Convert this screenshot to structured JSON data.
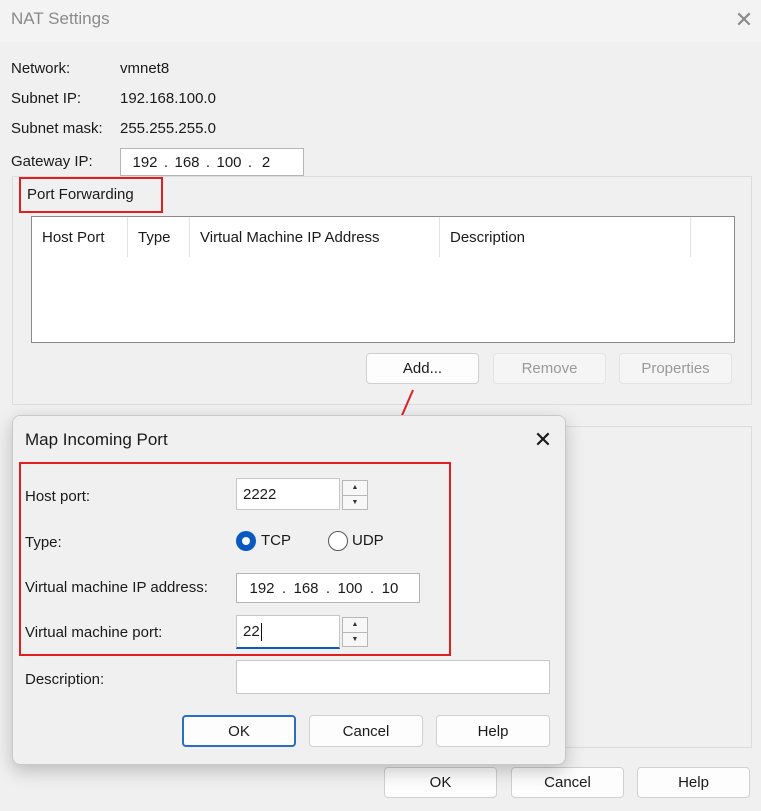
{
  "nat": {
    "title": "NAT Settings",
    "network_label": "Network:",
    "network_value": "vmnet8",
    "subnet_ip_label": "Subnet IP:",
    "subnet_ip_value": "192.168.100.0",
    "subnet_mask_label": "Subnet mask:",
    "subnet_mask_value": "255.255.255.0",
    "gateway_label": "Gateway IP:",
    "gateway_octets": [
      "192",
      "168",
      "100",
      "2"
    ],
    "port_forwarding_label": "Port Forwarding",
    "columns": [
      "Host Port",
      "Type",
      "Virtual Machine IP Address",
      "Description"
    ],
    "add_label": "Add...",
    "remove_label": "Remove",
    "properties_label": "Properties",
    "ok_label": "OK",
    "cancel_label": "Cancel",
    "help_label": "Help"
  },
  "map": {
    "title": "Map Incoming Port",
    "host_port_label": "Host port:",
    "host_port_value": "2222",
    "type_label": "Type:",
    "tcp_label": "TCP",
    "udp_label": "UDP",
    "selected_type": "TCP",
    "vm_ip_label": "Virtual machine IP address:",
    "vm_ip_octets": [
      "192",
      "168",
      "100",
      "10"
    ],
    "vm_port_label": "Virtual machine port:",
    "vm_port_value": "22",
    "description_label": "Description:",
    "description_value": "",
    "ok_label": "OK",
    "cancel_label": "Cancel",
    "help_label": "Help"
  },
  "colors": {
    "annotation": "#e02020",
    "accent": "#0a58c2"
  }
}
